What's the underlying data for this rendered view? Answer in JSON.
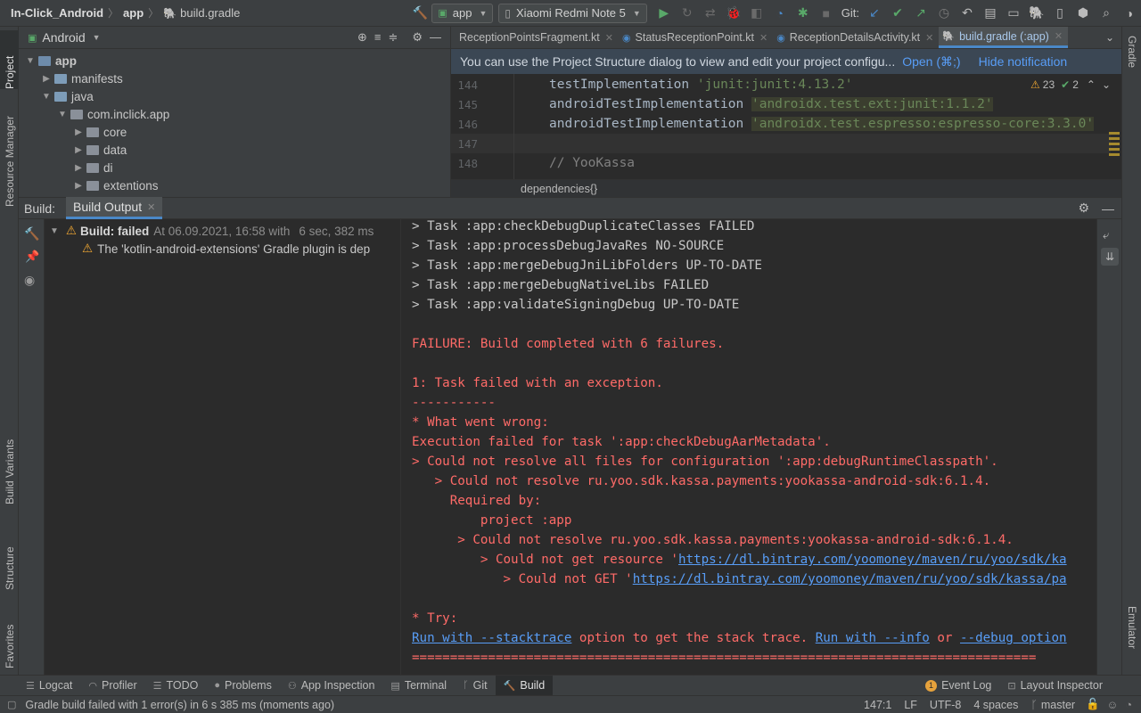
{
  "colors": {
    "accent": "#4a88c7",
    "success": "#59a869",
    "error": "#ff6b68",
    "warning": "#f0a732",
    "link": "#589df6"
  },
  "breadcrumb": [
    "In-Click_Android",
    "app",
    "build.gradle"
  ],
  "toolbar": {
    "run_config": "app",
    "device": "Xiaomi Redmi Note 5",
    "git_label": "Git:"
  },
  "left_stripe": {
    "project": "Project",
    "resource_manager": "Resource Manager",
    "build_variants": "Build Variants",
    "structure": "Structure",
    "favorites": "Favorites"
  },
  "right_stripe": {
    "gradle": "Gradle",
    "emulator": "Emulator"
  },
  "project_panel": {
    "view_mode": "Android",
    "tree": [
      {
        "label": "app",
        "level": 0,
        "kind": "module"
      },
      {
        "label": "manifests",
        "level": 1,
        "kind": "folder"
      },
      {
        "label": "java",
        "level": 1,
        "kind": "folder"
      },
      {
        "label": "com.inclick.app",
        "level": 2,
        "kind": "package"
      },
      {
        "label": "core",
        "level": 3,
        "kind": "package"
      },
      {
        "label": "data",
        "level": 3,
        "kind": "package"
      },
      {
        "label": "di",
        "level": 3,
        "kind": "package"
      },
      {
        "label": "extentions",
        "level": 3,
        "kind": "package"
      }
    ]
  },
  "editor": {
    "tabs": [
      {
        "label": "ReceptionPointsFragment.kt",
        "active": false
      },
      {
        "label": "StatusReceptionPoint.kt",
        "active": false
      },
      {
        "label": "ReceptionDetailsActivity.kt",
        "active": false
      },
      {
        "label": "build.gradle (:app)",
        "active": true
      }
    ],
    "notification": {
      "text": "You can use the Project Structure dialog to view and edit your project configu...",
      "open": "Open (⌘;)",
      "hide": "Hide notification"
    },
    "inspections": {
      "warnings": "23",
      "weak": "2"
    },
    "lines": [
      {
        "num": "144",
        "code": "testImplementation ",
        "str": "'junit:junit:4.13.2'",
        "hl": false
      },
      {
        "num": "145",
        "code": "androidTestImplementation ",
        "str": "'androidx.test.ext:junit:1.1.2'",
        "hl": true
      },
      {
        "num": "146",
        "code": "androidTestImplementation ",
        "str": "'androidx.test.espresso:espresso-core:3.3.0'",
        "hl": true
      },
      {
        "num": "147",
        "code": "",
        "str": "",
        "hl": false
      },
      {
        "num": "148",
        "code": "// YooKassa",
        "str": "",
        "hl": false
      }
    ],
    "breadcrumb": "dependencies{}"
  },
  "build": {
    "label": "Build:",
    "tab": "Build Output",
    "tree": {
      "status": "Build: failed",
      "timestamp": "At 06.09.2021, 16:58 with",
      "duration": "6 sec, 382 ms",
      "warning": "The 'kotlin-android-extensions' Gradle plugin is dep"
    },
    "console": [
      {
        "text": "> Task :app:checkDebugDuplicateClasses FAILED",
        "type": "norm"
      },
      {
        "text": "> Task :app:processDebugJavaRes NO-SOURCE",
        "type": "norm"
      },
      {
        "text": "> Task :app:mergeDebugJniLibFolders UP-TO-DATE",
        "type": "norm"
      },
      {
        "text": "> Task :app:mergeDebugNativeLibs FAILED",
        "type": "norm"
      },
      {
        "text": "> Task :app:validateSigningDebug UP-TO-DATE",
        "type": "norm"
      },
      {
        "text": "",
        "type": "norm"
      },
      {
        "text": "FAILURE: Build completed with 6 failures.",
        "type": "err"
      },
      {
        "text": "",
        "type": "norm"
      },
      {
        "text": "1: Task failed with an exception.",
        "type": "err"
      },
      {
        "text": "-----------",
        "type": "err"
      },
      {
        "text": "* What went wrong:",
        "type": "err"
      },
      {
        "text": "Execution failed for task ':app:checkDebugAarMetadata'.",
        "type": "err"
      },
      {
        "text": "> Could not resolve all files for configuration ':app:debugRuntimeClasspath'.",
        "type": "err"
      },
      {
        "text": "   > Could not resolve ru.yoo.sdk.kassa.payments:yookassa-android-sdk:6.1.4.",
        "type": "err"
      },
      {
        "text": "     Required by:",
        "type": "err"
      },
      {
        "text": "         project :app",
        "type": "err"
      },
      {
        "text": "      > Could not resolve ru.yoo.sdk.kassa.payments:yookassa-android-sdk:6.1.4.",
        "type": "err"
      },
      {
        "text": "         > Could not get resource '",
        "type": "err",
        "link": "https://dl.bintray.com/yoomoney/maven/ru/yoo/sdk/ka"
      },
      {
        "text": "            > Could not GET '",
        "type": "err",
        "link": "https://dl.bintray.com/yoomoney/maven/ru/yoo/sdk/kassa/pa"
      },
      {
        "text": "",
        "type": "norm"
      },
      {
        "text": "* Try:",
        "type": "err"
      },
      {
        "text": "",
        "type": "try"
      },
      {
        "text": "==================================================================================",
        "type": "err"
      }
    ],
    "try_line": {
      "a": "Run with --stacktrace",
      "b": " option to get the stack trace. ",
      "c": "Run with --info",
      "d": " or ",
      "e": "--debug option"
    }
  },
  "bottom_tabs": [
    {
      "label": "Logcat",
      "icon": "logcat-icon",
      "active": false
    },
    {
      "label": "Profiler",
      "icon": "profiler-icon",
      "active": false
    },
    {
      "label": "TODO",
      "icon": "todo-icon",
      "active": false
    },
    {
      "label": "Problems",
      "icon": "problems-icon",
      "active": false
    },
    {
      "label": "App Inspection",
      "icon": "inspection-icon",
      "active": false
    },
    {
      "label": "Terminal",
      "icon": "terminal-icon",
      "active": false
    },
    {
      "label": "Git",
      "icon": "git-icon",
      "active": false
    },
    {
      "label": "Build",
      "icon": "hammer-icon",
      "active": true
    }
  ],
  "bottom_right": {
    "event_log": "Event Log",
    "event_count": "1",
    "layout_inspector": "Layout Inspector"
  },
  "status_bar": {
    "message": "Gradle build failed with 1 error(s) in 6 s 385 ms (moments ago)",
    "position": "147:1",
    "line_sep": "LF",
    "encoding": "UTF-8",
    "indent": "4 spaces",
    "branch": "master"
  }
}
